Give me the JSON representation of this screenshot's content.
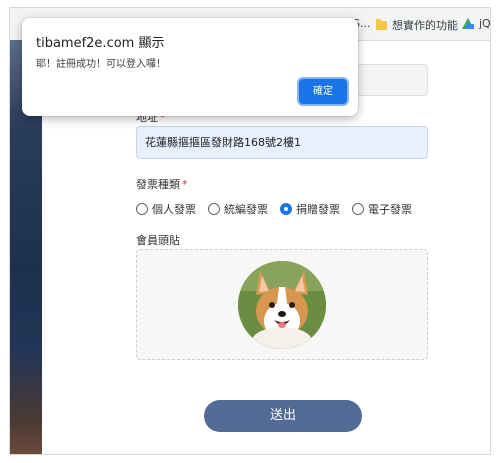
{
  "bookmarks": {
    "items": [
      {
        "label": "SS...",
        "icon": "folder-icon"
      },
      {
        "label": "想實作的功能",
        "icon": "folder-icon"
      },
      {
        "label": "jQ",
        "icon": "drive-icon"
      }
    ]
  },
  "dialog": {
    "title": "tibamef2e.com 顯示",
    "message": "耶！註冊成功！可以登入囉！",
    "ok_label": "確定"
  },
  "form": {
    "address_label": "地址",
    "address_value": "花蓮縣摳摳區發財路168號2樓1",
    "invoice_label": "發票種類",
    "invoice_options": [
      "個人發票",
      "統編發票",
      "捐贈發票",
      "電子發票"
    ],
    "invoice_selected": "捐贈發票",
    "avatar_label": "會員頭貼",
    "required_mark": "*",
    "submit_label": "送出"
  },
  "colors": {
    "accent": "#1a73e8",
    "submit_bg": "#526b94",
    "address_bg": "#e8f0fe"
  }
}
